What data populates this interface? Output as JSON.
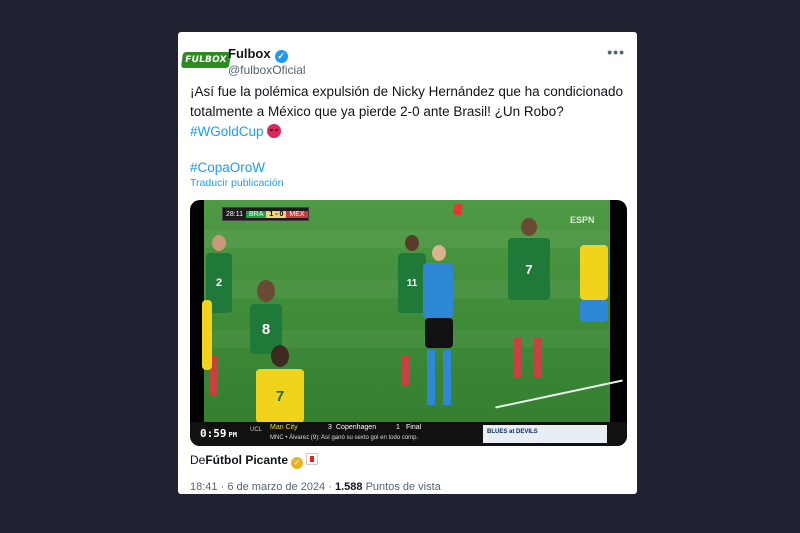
{
  "post": {
    "avatar_text": "FULBOX",
    "display_name": "Fulbox",
    "handle": "@fulboxOficial",
    "more_icon": "•••",
    "text_main": "¡Así fue la polémica expulsión de Nicky Hernández que ha condicionado totalmente a México que ya pierde 2-0 ante Brasil! ¿Un Robo?",
    "hashtag1": "#WGoldCup",
    "hashtag2": "#CopaOroW",
    "translate_label": "Traducir publicación",
    "quote_prefix": "De",
    "quote_source": "Fútbol Picante",
    "time": "18:41",
    "separator": "·",
    "date": "6 de marzo de 2024",
    "views_count": "1.588",
    "views_label": "Puntos de vista"
  },
  "video": {
    "scorebug": {
      "time": "28:11",
      "team1": "BRA",
      "score": "1 - 0",
      "team2": "MEX"
    },
    "broadcaster": "ESPN",
    "clock": "0:59",
    "clock_suffix": "PM",
    "ticker_league": "UCL",
    "ticker_team1": "Man City",
    "ticker_score1": "3",
    "ticker_team2": "Copenhagen",
    "ticker_score2": "1",
    "ticker_status": "Final",
    "ticker_line2": "MNC • Álvarez (9): Así ganó su sexto gol en todo comp.",
    "nhl_text": "BLUES at DEVILS"
  },
  "colors": {
    "page_bg": "#1f2230",
    "link": "#1d9bf0",
    "pitch": "#3d8a37",
    "mexico_kit": "#1f7a3a",
    "brazil_kit": "#f2d31b",
    "referee": "#2e88d6"
  }
}
